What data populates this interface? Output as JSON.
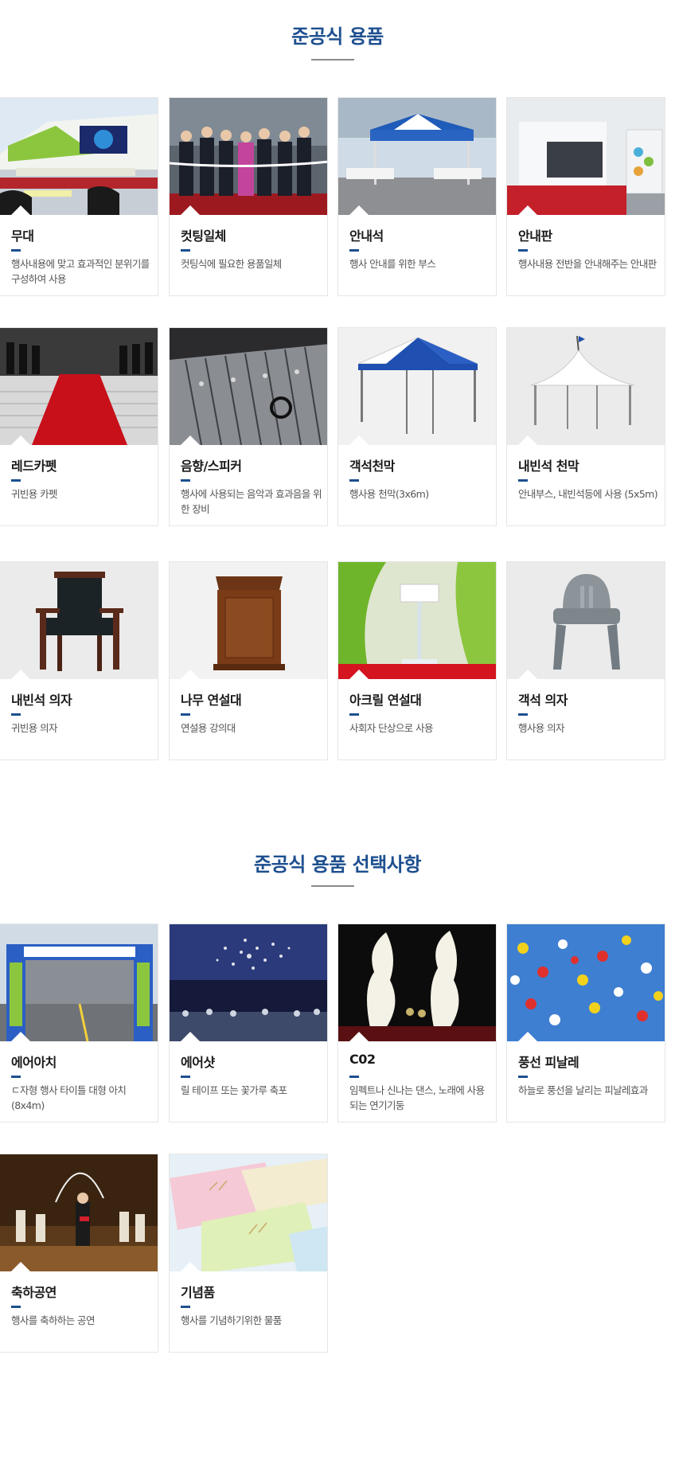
{
  "sections": [
    {
      "title": "준공식 용품",
      "items": [
        {
          "name": "무대",
          "desc": "행사내용에 맞고 효과적인 분위기를 구성하여 사용"
        },
        {
          "name": "컷팅일체",
          "desc": "컷팅식에 필요한 용품일체"
        },
        {
          "name": "안내석",
          "desc": "행사 안내를 위한 부스"
        },
        {
          "name": "안내판",
          "desc": "행사내용 전반을 안내해주는 안내판"
        },
        {
          "name": "레드카펫",
          "desc": "귀빈용 카펫"
        },
        {
          "name": "음향/스피커",
          "desc": "행사에 사용되는 음악과 효과음을 위한 장비"
        },
        {
          "name": "객석천막",
          "desc": "행사용 천막(3x6m)"
        },
        {
          "name": "내빈석 천막",
          "desc": "안내부스, 내빈석등에 사용 (5x5m)"
        },
        {
          "name": "내빈석 의자",
          "desc": "귀빈용 의자"
        },
        {
          "name": "나무 연설대",
          "desc": "연설용 강의대"
        },
        {
          "name": "아크릴 연설대",
          "desc": "사회자 단상으로 사용"
        },
        {
          "name": "객석 의자",
          "desc": "행사용 의자"
        }
      ]
    },
    {
      "title": "준공식 용품 선택사항",
      "items": [
        {
          "name": "에어아치",
          "desc": "ㄷ자형 행사 타이틀 대형 아치 (8x4m)"
        },
        {
          "name": "에어샷",
          "desc": "릴 테이프 또는 꽃가루 축포"
        },
        {
          "name": "C02",
          "desc": "임펙트나 신나는 댄스, 노래에 사용되는 연기기둥"
        },
        {
          "name": "풍선 피날레",
          "desc": "하늘로 풍선을 날리는 피날레효과"
        },
        {
          "name": "축하공연",
          "desc": "행사를 축하하는 공연"
        },
        {
          "name": "기념품",
          "desc": "행사를 기념하기위한 물품"
        }
      ]
    }
  ],
  "colors": {
    "accent": "#1d4f8f",
    "divider": "#8a8a8a",
    "card_border": "#e6e6e6"
  }
}
